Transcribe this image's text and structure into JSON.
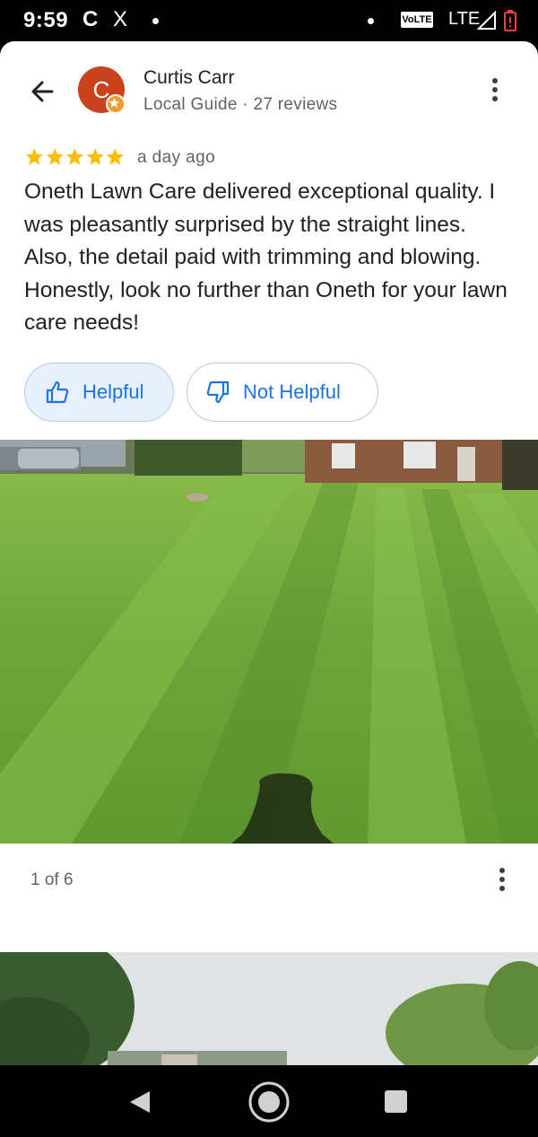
{
  "status_bar": {
    "time": "9:59",
    "app_icon_c": "C",
    "app_icon_x": "X",
    "volte": "VoLTE",
    "network": "LTE"
  },
  "review": {
    "author_initial": "C",
    "author_name": "Curtis Carr",
    "author_meta": "Local Guide · 27 reviews",
    "rating": 5,
    "date": "a day ago",
    "text": "Oneth Lawn Care delivered exceptional quality. I was pleasantly surprised by the straight lines. Also, the detail paid with trimming and blowing. Honestly, look no further than Oneth for your lawn care needs!",
    "helpful_label": "Helpful",
    "not_helpful_label": "Not Helpful"
  },
  "photos": {
    "counter": "1 of 6"
  },
  "colors": {
    "accent": "#1a73e8",
    "star": "#fbbc04",
    "avatar": "#c9421c",
    "helpful_bg": "#e8f0fe"
  },
  "icons": {
    "back": "arrow-left-icon",
    "more": "more-vert-icon",
    "thumbs_up": "thumbs-up-icon",
    "thumbs_down": "thumbs-down-icon",
    "star": "star-icon",
    "local_guide_badge": "local-guide-badge-icon",
    "nav_back": "nav-back-icon",
    "nav_home": "nav-home-icon",
    "nav_recents": "nav-recents-icon"
  }
}
